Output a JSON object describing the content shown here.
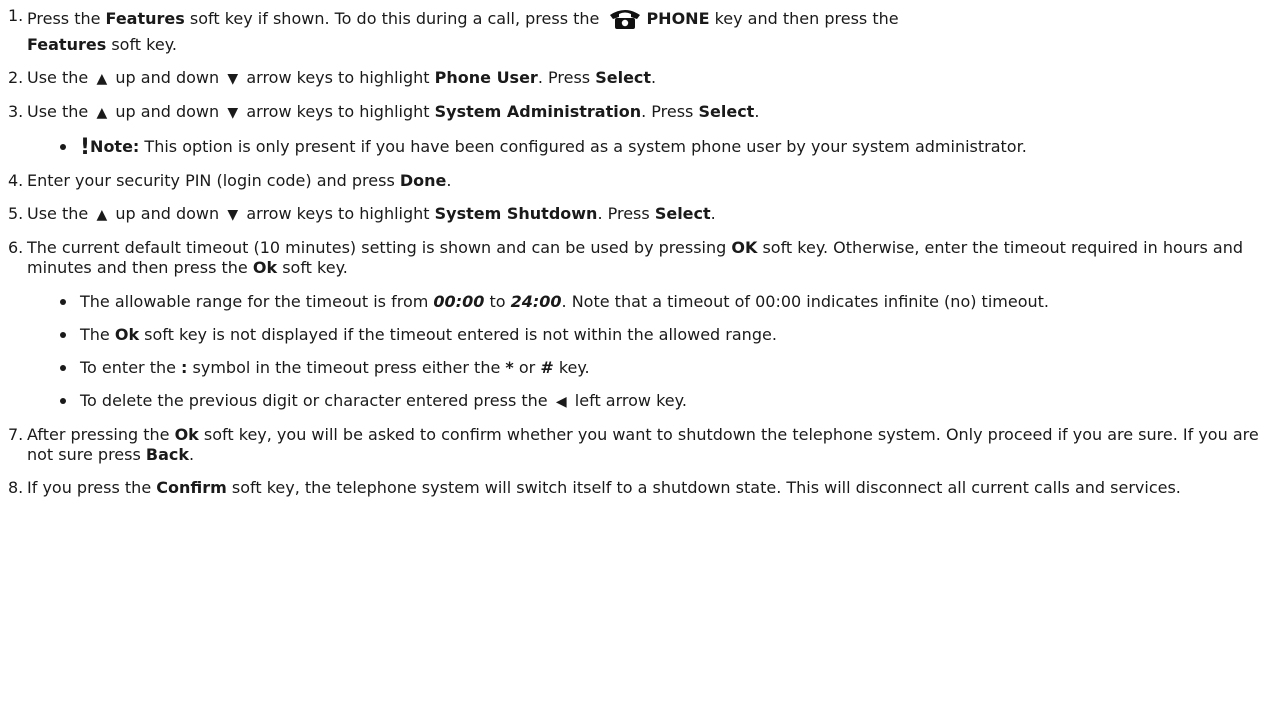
{
  "steps": [
    {
      "n": "1.",
      "a": "Press the ",
      "b1": "Features",
      "c": " soft key if shown. To do this during a call, press the ",
      "b2": "PHONE",
      "d": " key and then press the",
      "b3": "Features",
      "e": " soft key."
    },
    {
      "n": "2.",
      "a": "Use the ",
      "b": " up and down ",
      "c": " arrow keys to highlight ",
      "bold1": "Phone User",
      "d": ". Press ",
      "bold2": "Select",
      "e": "."
    },
    {
      "n": "3.",
      "a": "Use the ",
      "b": " up and down ",
      "c": " arrow keys to highlight ",
      "bold1": "System Administration",
      "d": ". Press ",
      "bold2": "Select",
      "e": ".",
      "note_mark": "!",
      "note_label": "Note:",
      "note_text": " This option is only present if you have been configured as a system phone user by your system administrator."
    },
    {
      "n": "4.",
      "a": "Enter your security PIN (login code) and press ",
      "bold1": "Done",
      "e": "."
    },
    {
      "n": "5.",
      "a": "Use the ",
      "b": " up and down ",
      "c": " arrow keys to highlight ",
      "bold1": "System Shutdown",
      "d": ". Press ",
      "bold2": "Select",
      "e": "."
    },
    {
      "n": "6.",
      "a": "The current default timeout (10 minutes) setting is shown and can be used by pressing ",
      "bold1": "OK",
      "b": " soft key. Otherwise, enter the timeout required in hours and minutes and then press the ",
      "bold2": "Ok",
      "c": " soft key.",
      "sub": [
        {
          "a": "The allowable range for the timeout is from ",
          "bi1": "00:00",
          "b": " to ",
          "bi2": "24:00",
          "c": ". Note that a timeout of 00:00 indicates infinite (no) timeout."
        },
        {
          "a": "The ",
          "bold": "Ok",
          "b": " soft key is not displayed if the timeout entered is not within the allowed range."
        },
        {
          "a": "To enter the ",
          "bold1": ":",
          "b": " symbol in the timeout press either the ",
          "bold2": "*",
          "c": " or ",
          "bold3": "#",
          "d": " key."
        },
        {
          "a": "To delete the previous digit or character entered press the ",
          "b": " left arrow key."
        }
      ]
    },
    {
      "n": "7.",
      "a": "After pressing the ",
      "bold1": "Ok",
      "b": " soft key, you will be asked to confirm whether you want to shutdown the telephone system. Only proceed if you are sure. If you are not sure press ",
      "bold2": "Back",
      "c": "."
    },
    {
      "n": "8.",
      "a": "If you press the ",
      "bold1": "Confirm",
      "b": " soft key, the telephone system will switch itself to a shutdown state. This will disconnect all current calls and services."
    }
  ],
  "icons": {
    "up_arrow": "▲",
    "down_arrow": "▼",
    "left_arrow": "◀",
    "phone": "phone-icon"
  }
}
